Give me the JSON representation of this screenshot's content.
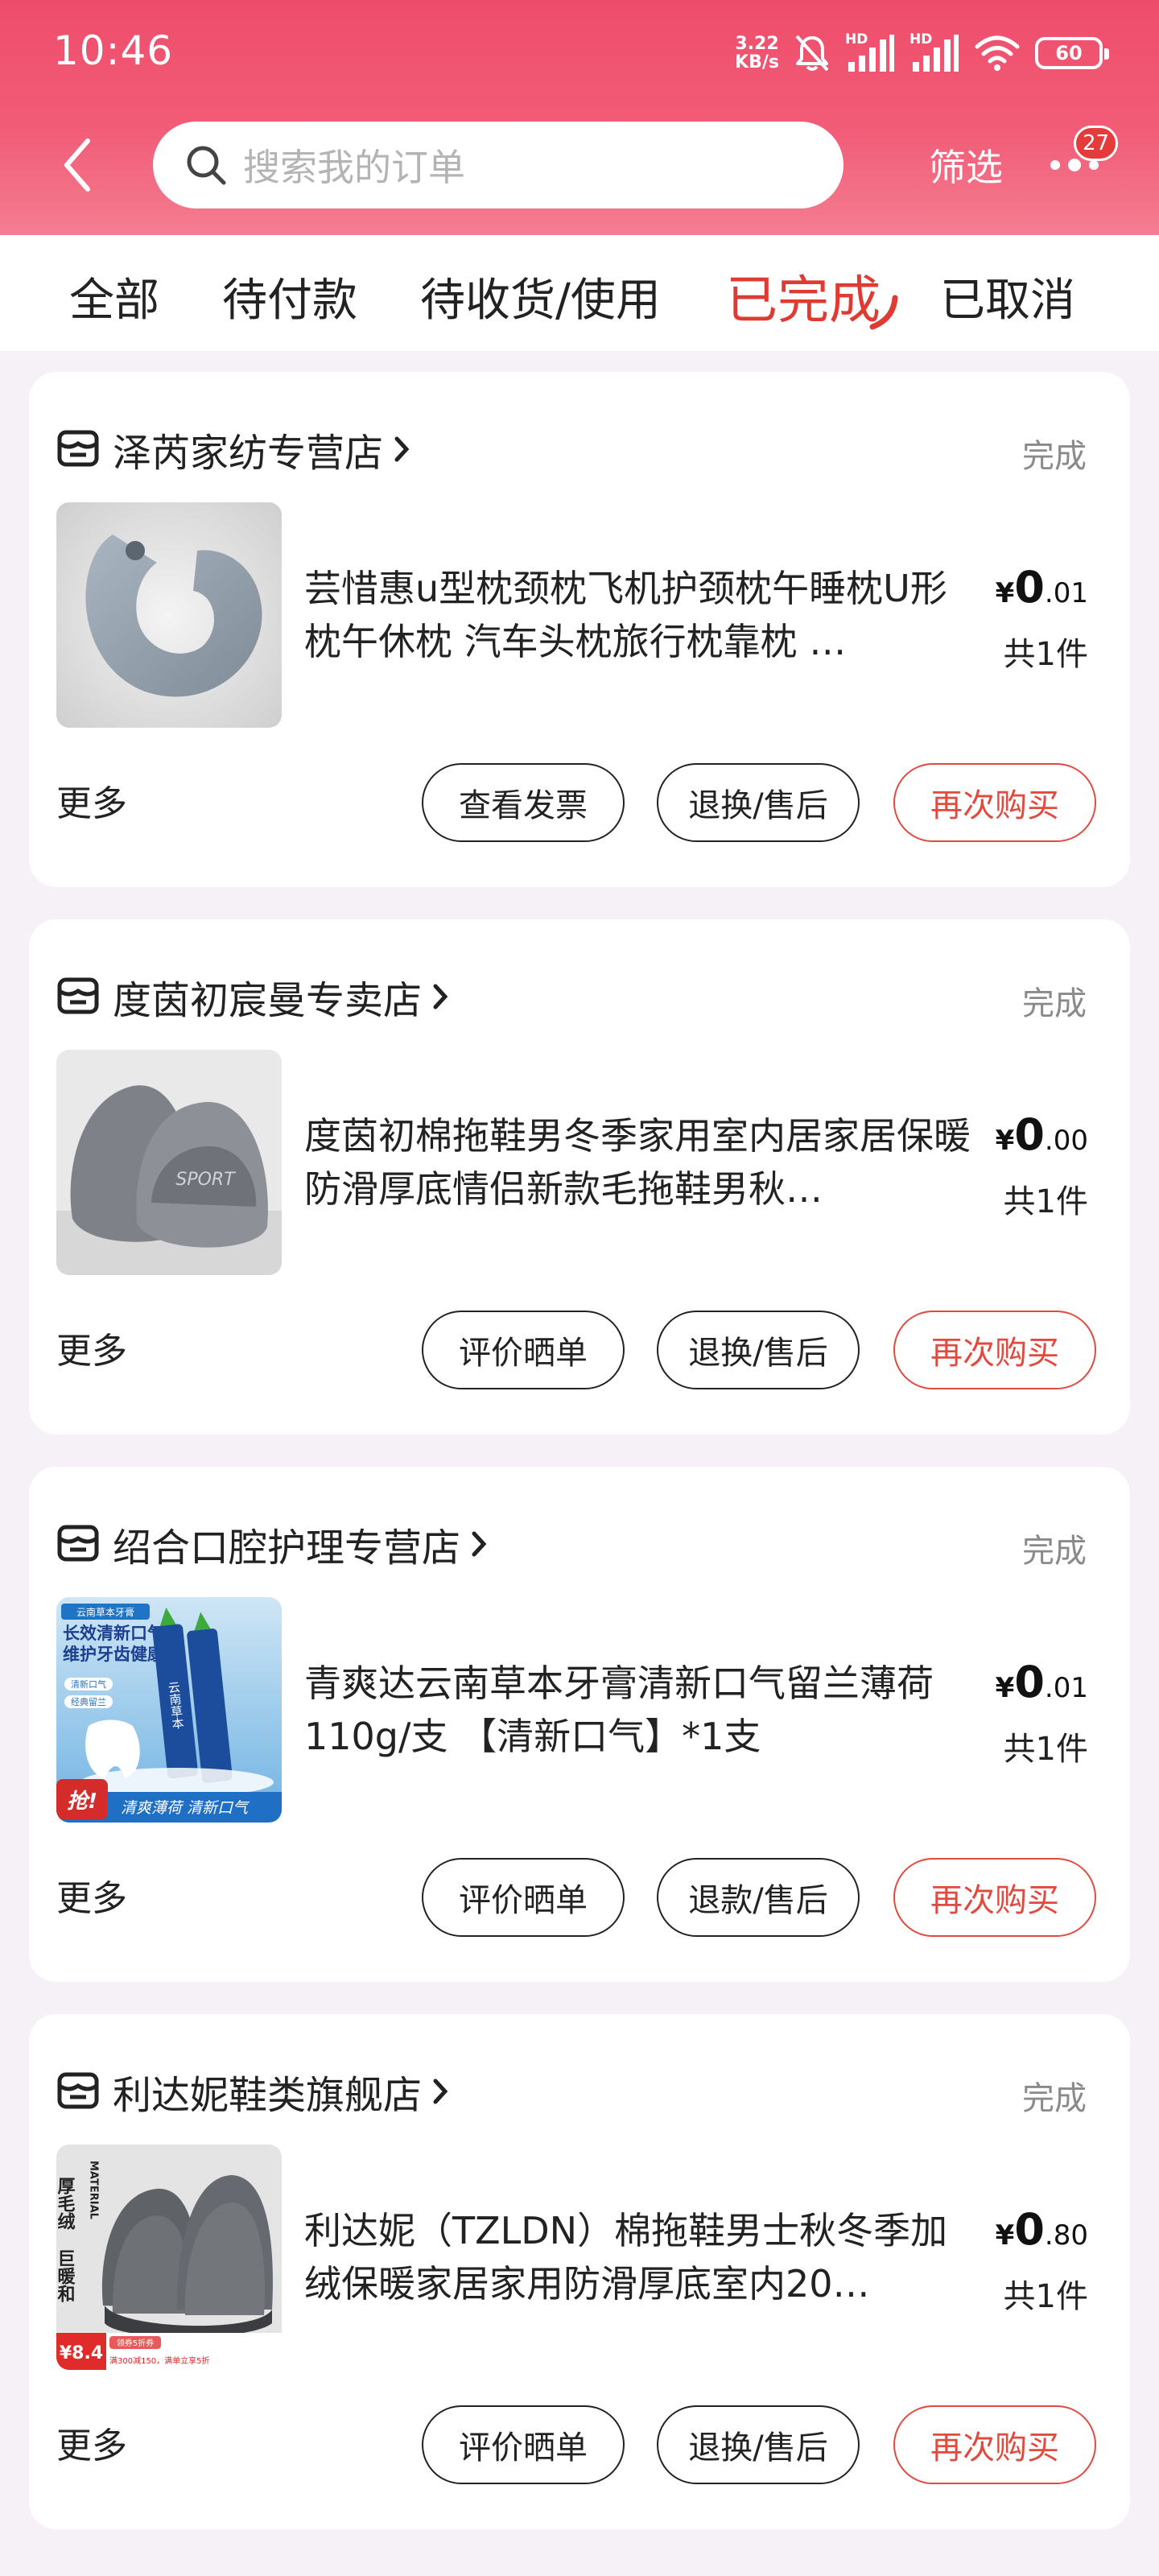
{
  "status_bar": {
    "time": "10:46",
    "net_speed_value": "3.22",
    "net_speed_unit": "KB/s",
    "signal1_label": "HD",
    "signal2_label": "HD",
    "battery": "60",
    "icons": [
      "mute-bell-icon",
      "signal-icon",
      "signal-icon",
      "wifi-icon",
      "battery-icon"
    ]
  },
  "header": {
    "search_placeholder": "搜索我的订单",
    "filter_label": "筛选",
    "message_badge": "27",
    "icons": [
      "back-icon",
      "search-icon",
      "more-icon"
    ]
  },
  "tabs": [
    {
      "label": "全部",
      "active": false
    },
    {
      "label": "待付款",
      "active": false
    },
    {
      "label": "待收货/使用",
      "active": false
    },
    {
      "label": "已完成",
      "active": true
    },
    {
      "label": "已取消",
      "active": false
    }
  ],
  "orders": [
    {
      "store": "泽芮家纺专营店",
      "status": "完成",
      "title": "芸惜惠u型枕颈枕飞机护颈枕午睡枕U形枕午休枕 汽车头枕旅行枕靠枕 …",
      "price_currency": "¥",
      "price_int": "0",
      "price_dec": ".01",
      "quantity": "共1件",
      "more": "更多",
      "buttons": [
        "查看发票",
        "退换/售后",
        "再次购买"
      ],
      "thumb": "neck-pillow-image"
    },
    {
      "store": "度茵初宸曼专卖店",
      "status": "完成",
      "title": "度茵初棉拖鞋男冬季家用室内居家居保暖防滑厚底情侣新款毛拖鞋男秋…",
      "price_currency": "¥",
      "price_int": "0",
      "price_dec": ".00",
      "quantity": "共1件",
      "more": "更多",
      "buttons": [
        "评价晒单",
        "退换/售后",
        "再次购买"
      ],
      "thumb": "gray-slippers-image",
      "thumb_text": "SPORT"
    },
    {
      "store": "绍合口腔护理专营店",
      "status": "完成",
      "title": "青爽达云南草本牙膏清新口气留兰薄荷110g/支 【清新口气】*1支",
      "price_currency": "¥",
      "price_int": "0",
      "price_dec": ".01",
      "quantity": "共1件",
      "more": "更多",
      "buttons": [
        "评价晒单",
        "退款/售后",
        "再次购买"
      ],
      "thumb": "toothpaste-image",
      "thumb_text": {
        "tag": "云南草本牙膏",
        "line1": "长效清新口气",
        "line2": "维护牙齿健康",
        "chip1": "清新口气",
        "chip2": "经典留兰",
        "grab": "抢!",
        "bottom": "清爽薄荷 清新口气",
        "tube": "云南草本"
      }
    },
    {
      "store": "利达妮鞋类旗舰店",
      "status": "完成",
      "title": "利达妮（TZLDN）棉拖鞋男士秋冬季加绒保暖家居家用防滑厚底室内20…",
      "price_currency": "¥",
      "price_int": "0",
      "price_dec": ".80",
      "quantity": "共1件",
      "more": "更多",
      "buttons": [
        "评价晒单",
        "退换/售后",
        "再次购买"
      ],
      "thumb": "striped-slippers-image",
      "thumb_text": {
        "side1": "厚毛绒",
        "side2": "巨暖和",
        "material": "MATERIAL",
        "price_tag": "¥8.4",
        "coupon": "领券5折券",
        "coupon2": "满300减150，满单立享5折"
      }
    }
  ]
}
